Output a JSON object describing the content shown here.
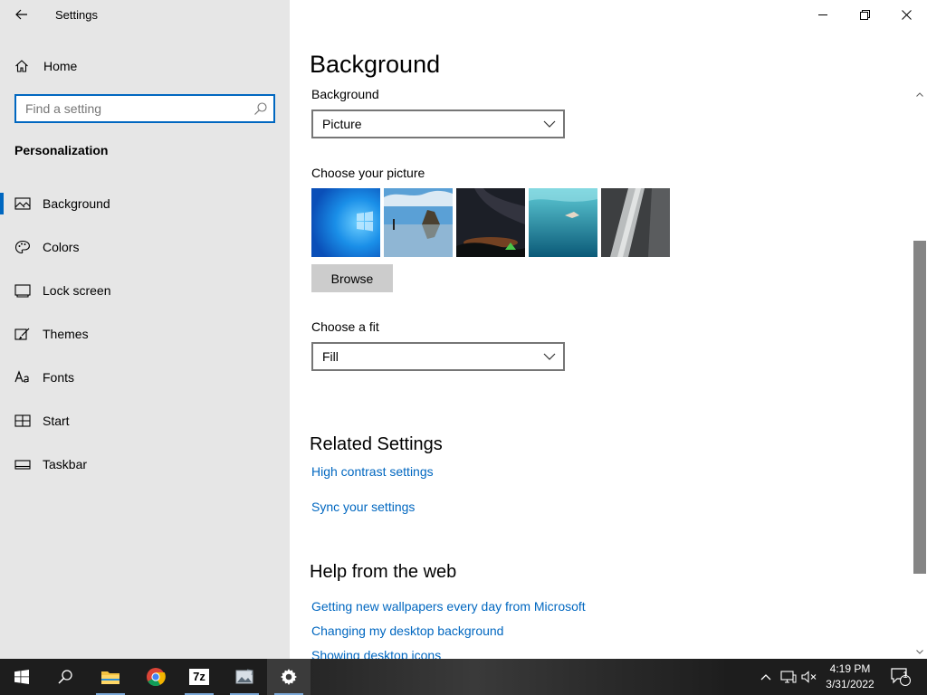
{
  "window": {
    "title": "Settings"
  },
  "sidebar": {
    "home_label": "Home",
    "search_placeholder": "Find a setting",
    "section_title": "Personalization",
    "items": [
      {
        "label": "Background",
        "icon": "picture-icon",
        "selected": true
      },
      {
        "label": "Colors",
        "icon": "palette-icon"
      },
      {
        "label": "Lock screen",
        "icon": "lock-screen-icon"
      },
      {
        "label": "Themes",
        "icon": "brush-icon"
      },
      {
        "label": "Fonts",
        "icon": "font-icon"
      },
      {
        "label": "Start",
        "icon": "start-grid-icon"
      },
      {
        "label": "Taskbar",
        "icon": "taskbar-icon"
      }
    ]
  },
  "main": {
    "title": "Background",
    "background_label": "Background",
    "background_value": "Picture",
    "choose_picture_label": "Choose your picture",
    "browse_label": "Browse",
    "fit_label": "Choose a fit",
    "fit_value": "Fill",
    "related_title": "Related Settings",
    "related_links": [
      "High contrast settings",
      "Sync your settings"
    ],
    "help_title": "Help from the web",
    "help_links": [
      "Getting new wallpapers every day from Microsoft",
      "Changing my desktop background",
      "Showing desktop icons"
    ]
  },
  "taskbar": {
    "time": "4:19 PM",
    "date": "3/31/2022",
    "notification_count": "1",
    "sevenzip_label": "7z"
  },
  "colors": {
    "accent": "#0067c0",
    "sidebar_bg": "#e6e6e6",
    "taskbar_bg": "#1d1d1d"
  }
}
